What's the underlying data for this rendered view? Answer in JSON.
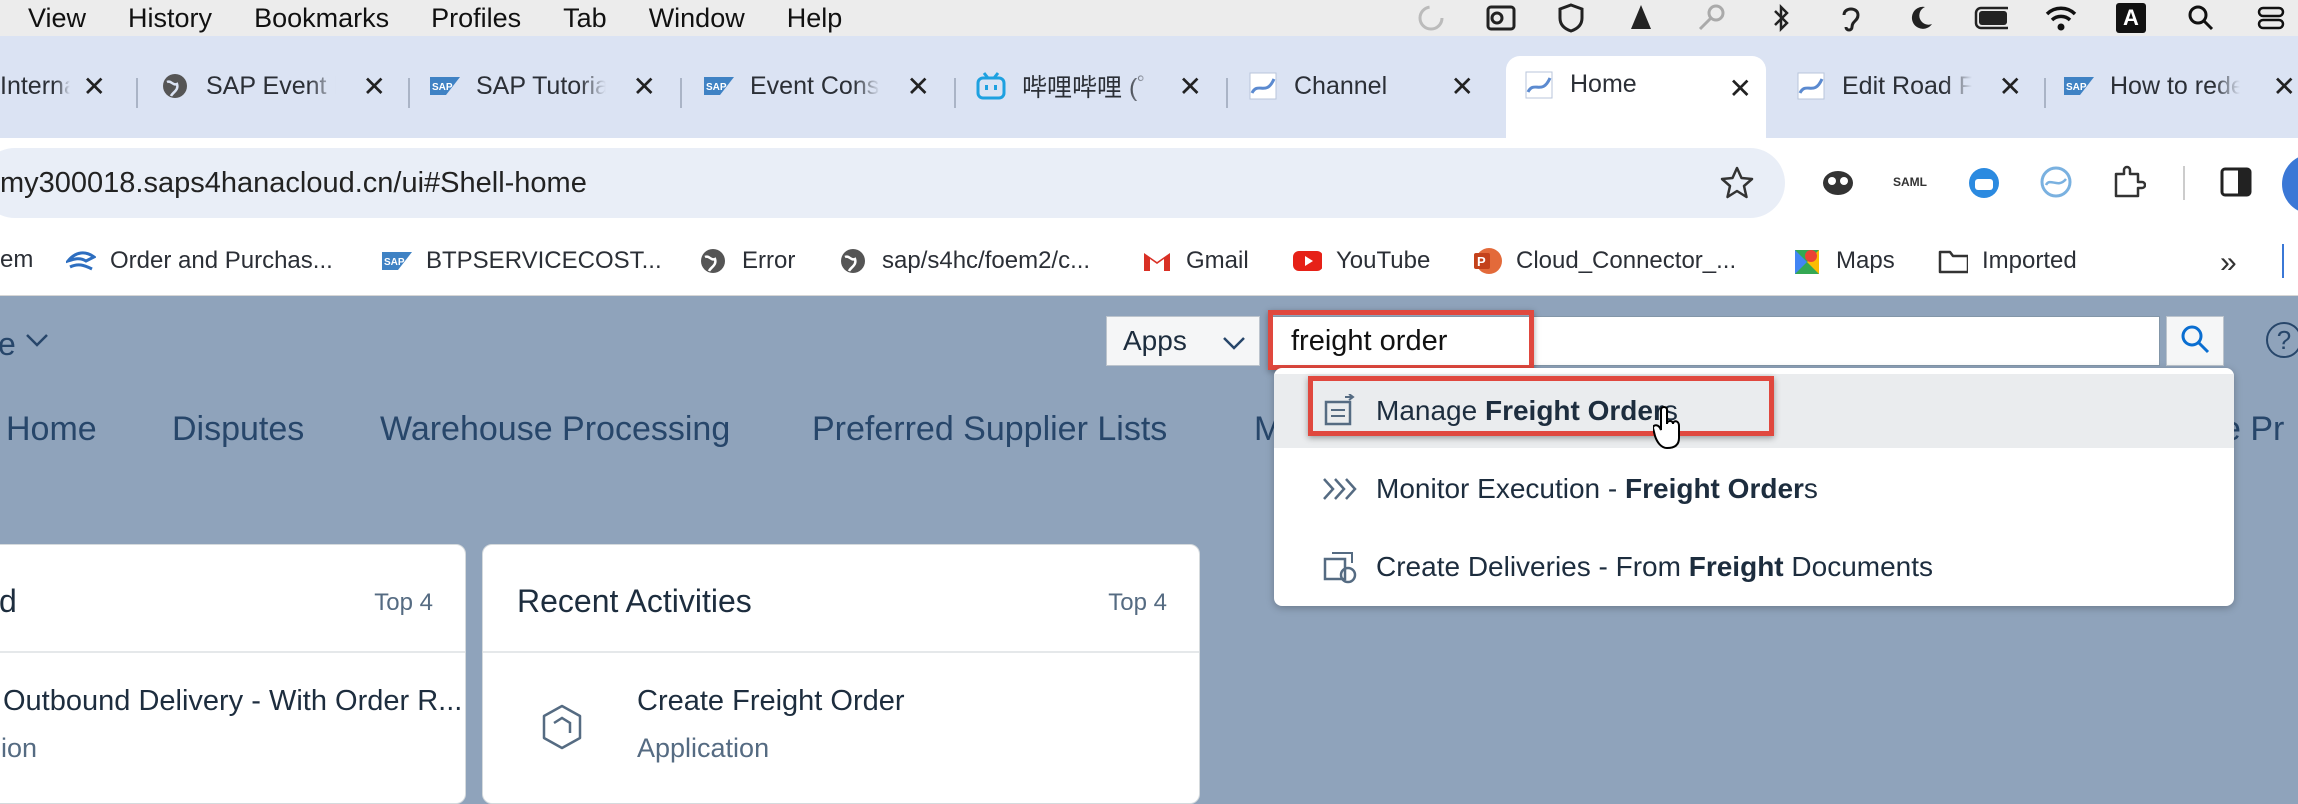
{
  "menubar": {
    "items": [
      "View",
      "History",
      "Bookmarks",
      "Profiles",
      "Tab",
      "Window",
      "Help"
    ],
    "status_icons": [
      "focus-icon",
      "outlook-icon",
      "vpn-shield-icon",
      "vlc-icon",
      "key-icon",
      "bluetooth-icon",
      "hearing-icon",
      "dark-mode-icon",
      "battery-icon",
      "wifi-icon",
      "input-source-icon",
      "spotlight-search-icon",
      "control-center-icon"
    ],
    "input_source_label": "A"
  },
  "tabs": [
    {
      "label": "Interna",
      "icon": "page-icon"
    },
    {
      "label": "SAP Event M",
      "icon": "globe-icon"
    },
    {
      "label": "SAP Tutoria",
      "icon": "sap-logo-icon"
    },
    {
      "label": "Event Cons",
      "icon": "sap-logo-icon"
    },
    {
      "label": "哔哩哔哩 (゜",
      "icon": "bilibili-icon"
    },
    {
      "label": "Channel",
      "icon": "sap-wave-icon"
    },
    {
      "label": "Home",
      "icon": "sap-wave-icon",
      "active": true
    },
    {
      "label": "Edit Road F",
      "icon": "sap-wave-icon"
    },
    {
      "label": "How to rede",
      "icon": "sap-logo-icon"
    }
  ],
  "toolbar": {
    "url": "my300018.saps4hanacloud.cn/ui#Shell-home",
    "extensions": [
      "ghost-extension-icon",
      "saml-extension-icon",
      "bilibili-extension-icon",
      "wave-extension-icon",
      "puzzle-extensions-icon",
      "sidepanel-icon"
    ],
    "saml_label": "SAML"
  },
  "bookmarks": [
    {
      "label": "em",
      "icon": ""
    },
    {
      "label": "Order and Purchas...",
      "icon": "sap-hat-icon"
    },
    {
      "label": "BTPSERVICECOST...",
      "icon": "sap-logo-icon"
    },
    {
      "label": "Error",
      "icon": "globe-icon"
    },
    {
      "label": "sap/s4hc/foem2/c...",
      "icon": "globe-icon"
    },
    {
      "label": "Gmail",
      "icon": "gmail-icon"
    },
    {
      "label": "YouTube",
      "icon": "youtube-icon"
    },
    {
      "label": "Cloud_Connector_...",
      "icon": "powerpoint-icon"
    },
    {
      "label": "Maps",
      "icon": "maps-icon"
    },
    {
      "label": "Imported",
      "icon": "folder-icon"
    }
  ],
  "shell": {
    "selector_label": "Apps",
    "search_value": "freight order",
    "nav_tabs": [
      "Home",
      "Disputes",
      "Warehouse Processing",
      "Preferred Supplier Lists",
      "M",
      "e Pr"
    ],
    "breadcrumb_fragment": "e"
  },
  "suggestions": [
    {
      "pre": "Manage ",
      "bold": "Freight Order",
      "post": "s",
      "icon": "manage-app-icon"
    },
    {
      "pre": "Monitor Execution - ",
      "bold": "Freight Order",
      "post": "s",
      "icon": "chevrons-icon"
    },
    {
      "pre": "Create Deliveries - From ",
      "bold": "Freight",
      "post": " Documents",
      "icon": "delivery-icon"
    }
  ],
  "cards": [
    {
      "title": "d",
      "top": "Top 4",
      "item_title": "Outbound Delivery - With Order R...",
      "item_sub": "ion"
    },
    {
      "title": "Recent Activities",
      "top": "Top 4",
      "item_title": "Create Freight Order",
      "item_sub": "Application"
    }
  ],
  "colors": {
    "shell_bg": "#8fa3bb",
    "highlight": "#e0483e",
    "tabbar": "#dbe3f3"
  }
}
